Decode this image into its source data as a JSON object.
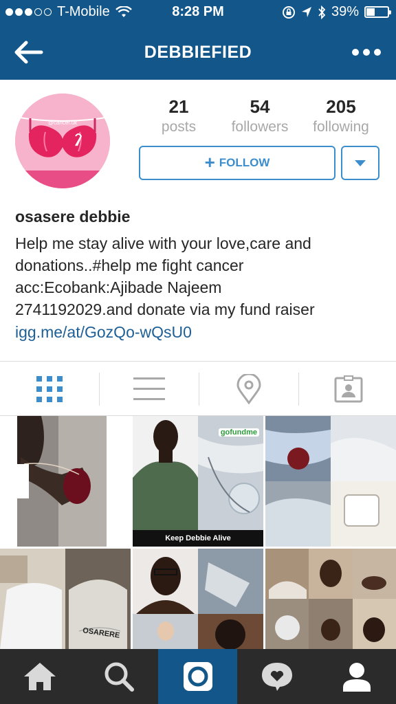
{
  "status_bar": {
    "carrier": "T-Mobile",
    "signal_bars": 3,
    "signal_total": 5,
    "time": "8:28 PM",
    "battery_percent": "39%",
    "battery_level": 0.39,
    "icons": [
      "wifi-icon",
      "rotation-lock-icon",
      "location-arrow-icon",
      "bluetooth-icon",
      "battery-icon"
    ]
  },
  "nav": {
    "title": "DEBBIEFIED",
    "back_icon": "back-arrow-icon",
    "more_icon": "more-dots-icon"
  },
  "profile": {
    "avatar_text": "@cancer.uk",
    "stats": [
      {
        "value": "21",
        "label": "posts"
      },
      {
        "value": "54",
        "label": "followers"
      },
      {
        "value": "205",
        "label": "following"
      }
    ],
    "follow_label": "FOLLOW",
    "name": "osasere debbie",
    "bio_lines": [
      "Help me stay alive with your love,care and",
      "donations..#help me fight cancer",
      "acc:Ecobank:Ajibade Najeem",
      "2741192029.and donate via my fund raiser"
    ],
    "link": "igg.me/at/GozQo-wQsU0"
  },
  "tabs": [
    "grid-view-icon",
    "list-view-icon",
    "location-pin-icon",
    "tagged-photos-icon"
  ],
  "grid": {
    "keep_label": "Keep Debbie Alive",
    "gofundme_label": "gofundme",
    "shirt_text": "OSARERE"
  },
  "colors": {
    "brand_blue": "#12568a",
    "button_blue": "#3b8dcc",
    "link_blue": "#1e5f96",
    "tabbar_dark": "#2b2b2b"
  },
  "bottom_tabs": [
    "home-icon",
    "search-icon",
    "camera-icon",
    "activity-icon",
    "profile-icon"
  ]
}
